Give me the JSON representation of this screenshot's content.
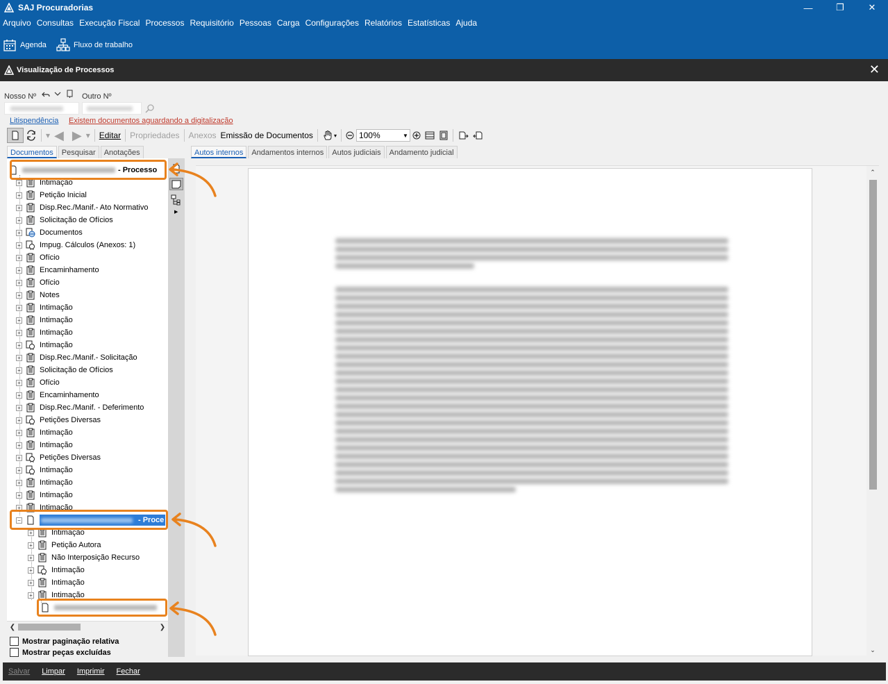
{
  "app": {
    "title": "SAJ Procuradorias"
  },
  "menu": [
    "Arquivo",
    "Consultas",
    "Execução Fiscal",
    "Processos",
    "Requisitório",
    "Pessoas",
    "Carga",
    "Configurações",
    "Relatórios",
    "Estatísticas",
    "Ajuda"
  ],
  "toolbar": {
    "agenda": "Agenda",
    "fluxo": "Fluxo de trabalho"
  },
  "window": {
    "title": "Visualização de Processos"
  },
  "fields": {
    "nosso_label": "Nosso Nº",
    "outro_label": "Outro Nº"
  },
  "links": {
    "litispendencia": "Litispendência",
    "aguardando": "Existem documentos aguardando a digitalização"
  },
  "doc_toolbar": {
    "editar": "Editar",
    "propriedades": "Propriedades",
    "anexos": "Anexos",
    "emissao": "Emissão de Documentos",
    "zoom": "100%"
  },
  "left_tabs": [
    "Documentos",
    "Pesquisar",
    "Anotações"
  ],
  "right_tabs": [
    "Autos internos",
    "Andamentos internos",
    "Autos judiciais",
    "Andamento judicial"
  ],
  "tree": {
    "root1_suffix": "- Processo",
    "root1_items": [
      "Intimação",
      "Petição Inicial",
      "Disp.Rec./Manif.- Ato Normativo",
      "Solicitação de Ofícios",
      "Documentos",
      "Impug. Cálculos (Anexos: 1)",
      "Ofício",
      "Encaminhamento",
      "Ofício",
      "Notes",
      "Intimação",
      "Intimação",
      "Intimação",
      "Intimação",
      "Disp.Rec./Manif.- Solicitação",
      "Solicitação de Ofícios",
      "Ofício",
      "Encaminhamento",
      "Disp.Rec./Manif. - Deferimento",
      "Petições Diversas",
      "Intimação",
      "Intimação",
      "Petições Diversas",
      "Intimação",
      "Intimação",
      "Intimação",
      "Intimação"
    ],
    "root2_suffix": "- Proce",
    "root2_items": [
      "Intimação",
      "Petição Autora",
      "Não Interposição Recurso",
      "Intimação",
      "Intimação",
      "Intimação"
    ]
  },
  "checks": {
    "paginacao": "Mostrar paginação relativa",
    "excluidas": "Mostrar peças excluídas"
  },
  "bottom": {
    "salvar": "Salvar",
    "limpar": "Limpar",
    "imprimir": "Imprimir",
    "fechar": "Fechar"
  },
  "colors": {
    "titlebar": "#0d5fa8",
    "highlight": "#e8821e",
    "link_red": "#c0392b"
  }
}
